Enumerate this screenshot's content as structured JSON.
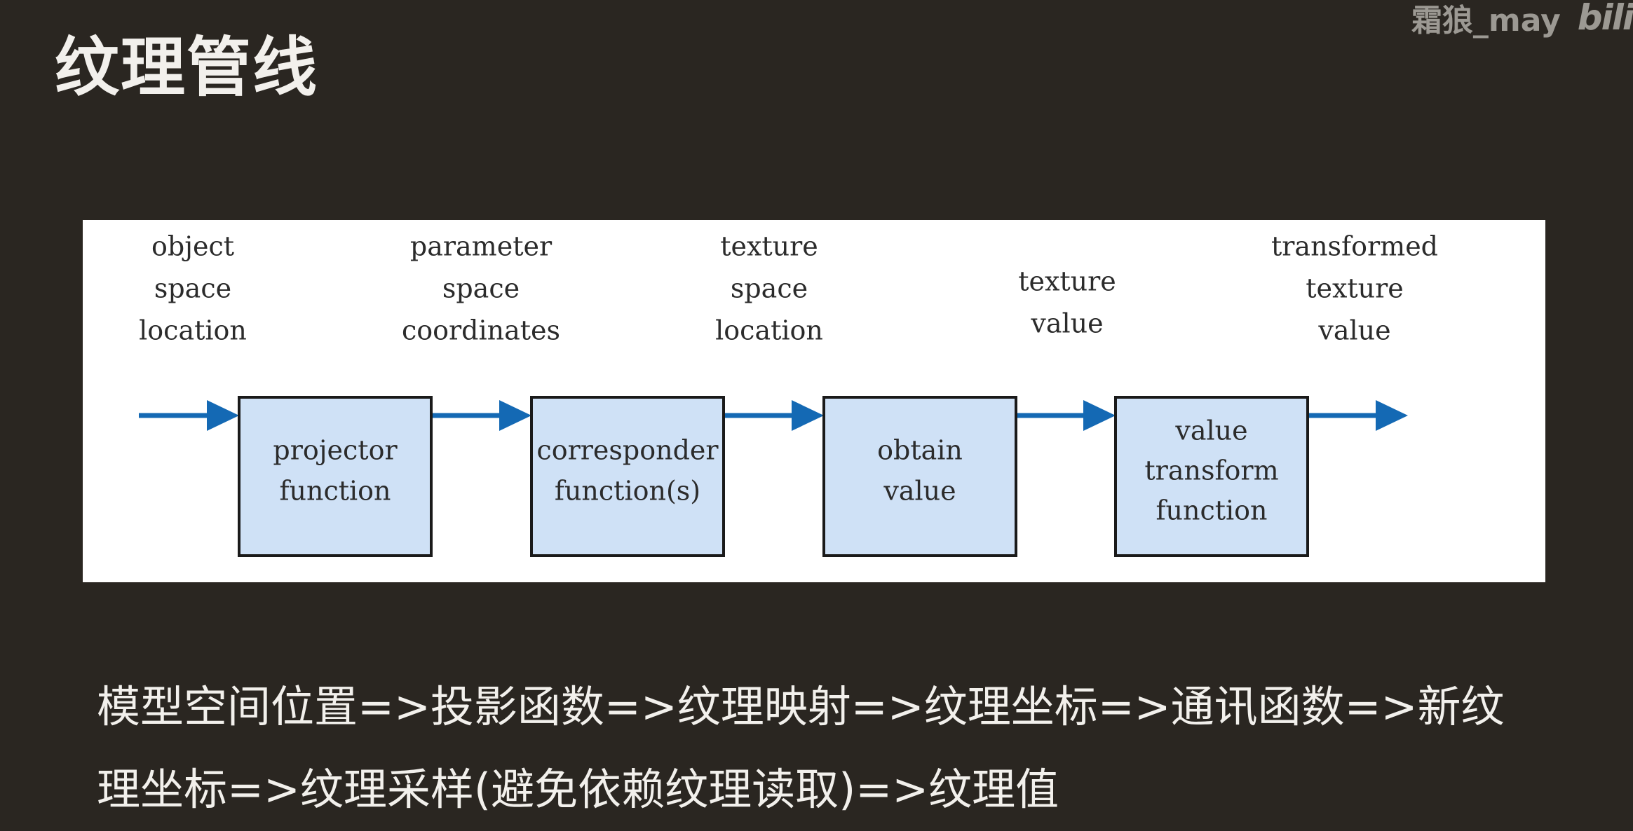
{
  "slide": {
    "title": "纹理管线",
    "caption": "模型空间位置=>投影函数=>纹理映射=>纹理坐标=>通讯函数=>新纹理坐标=>纹理采样(避免依赖纹理读取)=>纹理值"
  },
  "watermark": {
    "author": "霜狼_may",
    "brand": "bili"
  },
  "diagram": {
    "colors": {
      "arrow": "#1469b4",
      "box_fill": "#cfe1f6",
      "box_stroke": "#1a1a1a",
      "text": "#2b2b2b"
    },
    "boxes": [
      {
        "id": "projector",
        "lines": [
          "projector",
          "function"
        ]
      },
      {
        "id": "corresponder",
        "lines": [
          "corresponder",
          "function(s)"
        ]
      },
      {
        "id": "obtain",
        "lines": [
          "obtain",
          "value"
        ]
      },
      {
        "id": "transform",
        "lines": [
          "value",
          "transform",
          "function"
        ]
      }
    ],
    "labels": [
      {
        "id": "object-space-location",
        "lines": [
          "object",
          "space",
          "location"
        ]
      },
      {
        "id": "parameter-space-coordinates",
        "lines": [
          "parameter",
          "space",
          "coordinates"
        ]
      },
      {
        "id": "texture-space-location",
        "lines": [
          "texture",
          "space",
          "location"
        ]
      },
      {
        "id": "texture-value",
        "lines": [
          "texture",
          "value"
        ]
      },
      {
        "id": "transformed-texture-value",
        "lines": [
          "transformed",
          "texture",
          "value"
        ]
      }
    ]
  }
}
